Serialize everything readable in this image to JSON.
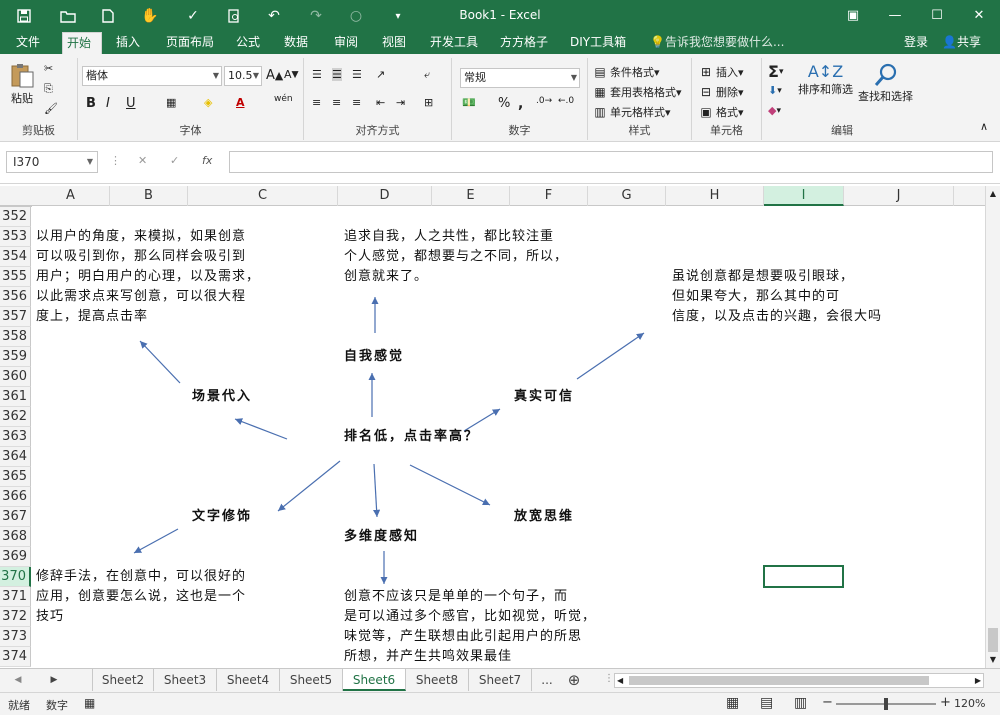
{
  "title": "Book1 - Excel",
  "quick_access": [
    "save-icon",
    "open-icon",
    "new-icon",
    "touch-icon",
    "spellcheck-icon",
    "print-preview-icon",
    "undo-icon",
    "redo-icon",
    "circle-icon",
    "customize-icon"
  ],
  "tabs": [
    {
      "label": "文件",
      "active": false
    },
    {
      "label": "开始",
      "active": true
    },
    {
      "label": "插入",
      "active": false
    },
    {
      "label": "页面布局",
      "active": false
    },
    {
      "label": "公式",
      "active": false
    },
    {
      "label": "数据",
      "active": false
    },
    {
      "label": "审阅",
      "active": false
    },
    {
      "label": "视图",
      "active": false
    },
    {
      "label": "开发工具",
      "active": false
    },
    {
      "label": "方方格子",
      "active": false
    },
    {
      "label": "DIY工具箱",
      "active": false
    }
  ],
  "tell_me": "告诉我您想要做什么...",
  "login": "登录",
  "share": "共享",
  "ribbon": {
    "clipboard": {
      "label": "剪贴板",
      "paste": "粘贴"
    },
    "font": {
      "label": "字体",
      "name": "楷体",
      "size": "10.5",
      "bold": "B",
      "italic": "I",
      "underline": "U",
      "phonetic": "wén"
    },
    "alignment": {
      "label": "对齐方式"
    },
    "number": {
      "label": "数字",
      "format": "常规",
      "percent": "%",
      "comma": ","
    },
    "styles": {
      "label": "样式",
      "conditional": "条件格式",
      "table": "套用表格格式",
      "cell": "单元格样式"
    },
    "cells": {
      "label": "单元格",
      "insert": "插入",
      "delete": "删除",
      "format": "格式"
    },
    "editing": {
      "label": "编辑",
      "sort": "排序和筛选",
      "find": "查找和选择"
    }
  },
  "name_box": "I370",
  "fx": "fx",
  "columns": [
    "A",
    "B",
    "C",
    "D",
    "E",
    "F",
    "G",
    "H",
    "I",
    "J"
  ],
  "selected_column": "I",
  "rows": [
    "352",
    "353",
    "354",
    "355",
    "356",
    "357",
    "358",
    "359",
    "360",
    "361",
    "362",
    "363",
    "364",
    "365",
    "366",
    "367",
    "368",
    "369",
    "370",
    "371",
    "372",
    "373",
    "374"
  ],
  "selected_row": "370",
  "content": {
    "text_scenario": [
      "以用户的角度，来模拟，如果创意",
      "可以吸引到你，那么同样会吸引到",
      "用户；明白用户的心理，以及需求，",
      "以此需求点来写创意，可以很大程",
      "度上，提高点击率"
    ],
    "text_self": [
      "追求自我，人之共性，都比较注重",
      "个人感觉，都想要与之不同，所以，",
      "创意就来了。"
    ],
    "text_real": [
      "虽说创意都是想要吸引眼球，",
      "但如果夸大，那么其中的可",
      "信度，以及点击的兴趣，会很大吗"
    ],
    "text_rhetoric": [
      "修辞手法，在创意中，可以很好的",
      "应用，创意要怎么说，这也是一个",
      "技巧"
    ],
    "text_multi": [
      "创意不应该只是单单的一个句子，而",
      "是可以通过多个感官，比如视觉，听觉，",
      "味觉等，产生联想由此引起用户的所思",
      "所想，并产生共鸣效果最佳"
    ],
    "node_center": "排名低，点击率高？",
    "node_self": "自我感觉",
    "node_scenario": "场景代入",
    "node_real": "真实可信",
    "node_rhetoric": "文字修饰",
    "node_widen": "放宽思维",
    "node_multi": "多维度感知"
  },
  "sheets": [
    {
      "label": "Sheet2",
      "active": false
    },
    {
      "label": "Sheet3",
      "active": false
    },
    {
      "label": "Sheet4",
      "active": false
    },
    {
      "label": "Sheet5",
      "active": false
    },
    {
      "label": "Sheet6",
      "active": true
    },
    {
      "label": "Sheet8",
      "active": false
    },
    {
      "label": "Sheet7",
      "active": false
    }
  ],
  "more_sheets": "...",
  "status": {
    "ready": "就绪",
    "numlock": "数字",
    "zoom": "120%"
  }
}
